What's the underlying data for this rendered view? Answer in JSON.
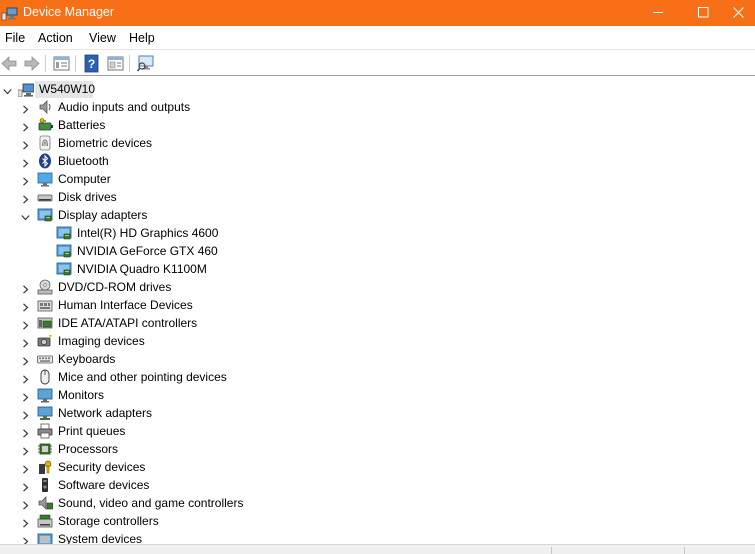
{
  "window": {
    "title": "Device Manager",
    "title_bar_color": "#f77018",
    "controls": [
      "minimize-icon",
      "maximize-icon",
      "close-icon"
    ]
  },
  "menu": {
    "file": "File",
    "action": "Action",
    "view": "View",
    "help": "Help"
  },
  "toolbar": {
    "buttons": [
      "back-arrow-icon",
      "forward-arrow-icon",
      "properties-icon",
      "help-icon",
      "show-hide-panel-icon",
      "scan-hardware-icon"
    ]
  },
  "tree": {
    "root": {
      "label": "W540W10",
      "expanded": true,
      "selected": true
    },
    "categories": [
      {
        "label": "Audio inputs and outputs",
        "icon": "speaker-icon",
        "expanded": false
      },
      {
        "label": "Batteries",
        "icon": "battery-icon",
        "expanded": false
      },
      {
        "label": "Biometric devices",
        "icon": "fingerprint-icon",
        "expanded": false
      },
      {
        "label": "Bluetooth",
        "icon": "bluetooth-icon",
        "expanded": false
      },
      {
        "label": "Computer",
        "icon": "computer-icon",
        "expanded": false
      },
      {
        "label": "Disk drives",
        "icon": "disk-drive-icon",
        "expanded": false
      },
      {
        "label": "Display adapters",
        "icon": "display-adapter-icon",
        "expanded": true,
        "children": [
          {
            "label": "Intel(R) HD Graphics 4600",
            "icon": "display-adapter-icon"
          },
          {
            "label": "NVIDIA GeForce GTX 460",
            "icon": "display-adapter-icon"
          },
          {
            "label": "NVIDIA Quadro K1100M",
            "icon": "display-adapter-icon"
          }
        ]
      },
      {
        "label": "DVD/CD-ROM drives",
        "icon": "dvd-drive-icon",
        "expanded": false
      },
      {
        "label": "Human Interface Devices",
        "icon": "hid-icon",
        "expanded": false
      },
      {
        "label": "IDE ATA/ATAPI controllers",
        "icon": "ide-controller-icon",
        "expanded": false
      },
      {
        "label": "Imaging devices",
        "icon": "camera-icon",
        "expanded": false
      },
      {
        "label": "Keyboards",
        "icon": "keyboard-icon",
        "expanded": false
      },
      {
        "label": "Mice and other pointing devices",
        "icon": "mouse-icon",
        "expanded": false
      },
      {
        "label": "Monitors",
        "icon": "monitor-icon",
        "expanded": false
      },
      {
        "label": "Network adapters",
        "icon": "network-adapter-icon",
        "expanded": false
      },
      {
        "label": "Print queues",
        "icon": "printer-icon",
        "expanded": false
      },
      {
        "label": "Processors",
        "icon": "processor-icon",
        "expanded": false
      },
      {
        "label": "Security devices",
        "icon": "security-key-icon",
        "expanded": false
      },
      {
        "label": "Software devices",
        "icon": "software-device-icon",
        "expanded": false
      },
      {
        "label": "Sound, video and game controllers",
        "icon": "sound-icon",
        "expanded": false
      },
      {
        "label": "Storage controllers",
        "icon": "storage-controller-icon",
        "expanded": false
      },
      {
        "label": "System devices",
        "icon": "system-device-icon",
        "expanded": false
      }
    ]
  }
}
